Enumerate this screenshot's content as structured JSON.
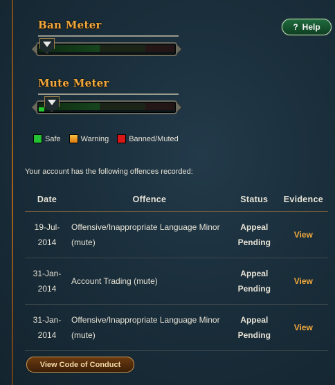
{
  "ban_meter": {
    "title": "Ban Meter",
    "level_fraction": 0.0
  },
  "mute_meter": {
    "title": "Mute Meter",
    "level_fraction": 0.04
  },
  "help": {
    "label": "Help",
    "icon": "?"
  },
  "legend": [
    {
      "label": "Safe",
      "color": "#22c232"
    },
    {
      "label": "Warning",
      "color": "#f0a02a"
    },
    {
      "label": "Banned/Muted",
      "color": "#d81818"
    }
  ],
  "intro_text": "Your account has the following offences recorded:",
  "table": {
    "headers": {
      "date": "Date",
      "offence": "Offence",
      "status": "Status",
      "evidence": "Evidence"
    },
    "rows": [
      {
        "date_line1": "19-Jul-",
        "date_line2": "2014",
        "offence": "Offensive/Inappropriate Language Minor (mute)",
        "status_line1": "Appeal",
        "status_line2": "Pending",
        "evidence": "View"
      },
      {
        "date_line1": "31-Jan-",
        "date_line2": "2014",
        "offence": "Account Trading (mute)",
        "status_line1": "Appeal",
        "status_line2": "Pending",
        "evidence": "View"
      },
      {
        "date_line1": "31-Jan-",
        "date_line2": "2014",
        "offence": "Offensive/Inappropriate Language Minor (mute)",
        "status_line1": "Appeal",
        "status_line2": "Pending",
        "evidence": "View"
      }
    ]
  },
  "conduct_button": {
    "label": "View Code of Conduct"
  },
  "colors": {
    "accent_orange": "#f2a93c",
    "help_green": "#1f6b3e"
  }
}
